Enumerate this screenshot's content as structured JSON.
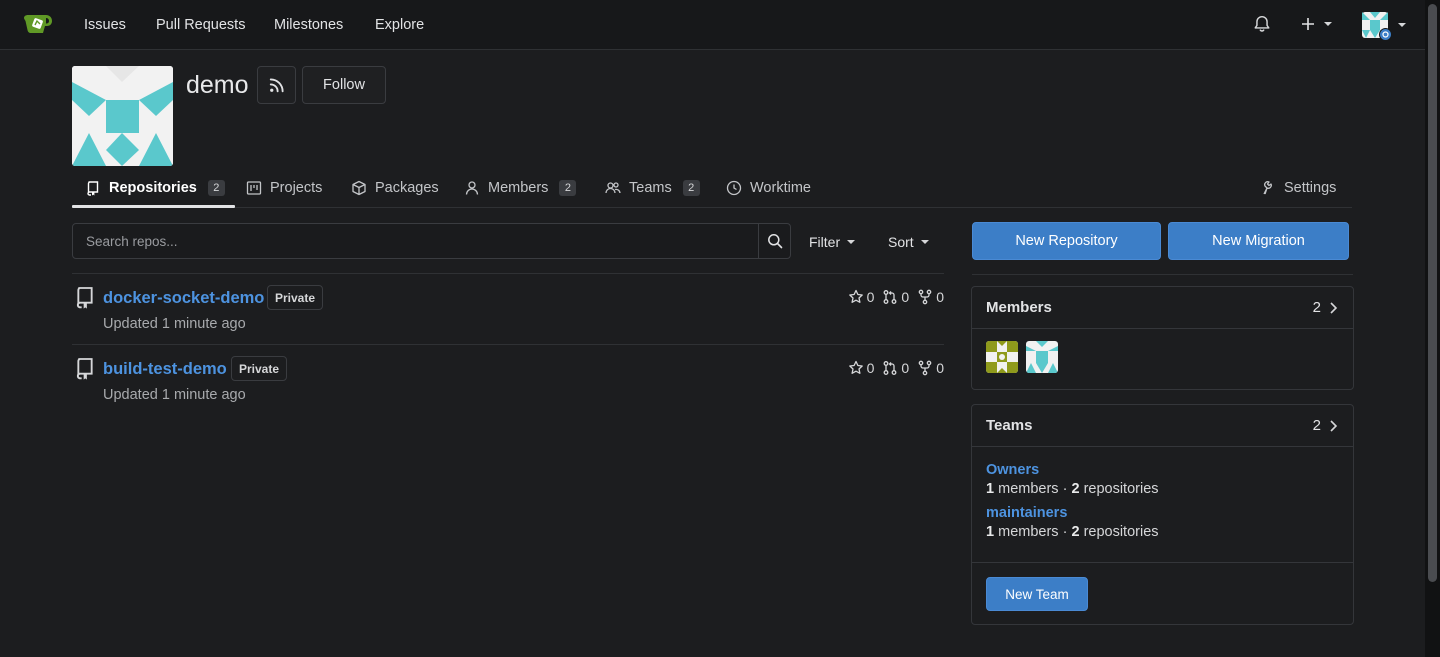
{
  "navbar": {
    "links": [
      "Issues",
      "Pull Requests",
      "Milestones",
      "Explore"
    ],
    "icons": [
      "gitea-logo-icon",
      "bell-icon",
      "plus-icon",
      "user-avatar"
    ]
  },
  "org": {
    "name": "demo",
    "follow_label": "Follow"
  },
  "tabs": [
    {
      "label": "Repositories",
      "badge": "2",
      "icon": "repo-icon"
    },
    {
      "label": "Projects",
      "badge": "",
      "icon": "project-icon"
    },
    {
      "label": "Packages",
      "badge": "",
      "icon": "package-icon"
    },
    {
      "label": "Members",
      "badge": "2",
      "icon": "person-icon"
    },
    {
      "label": "Teams",
      "badge": "2",
      "icon": "people-icon"
    },
    {
      "label": "Worktime",
      "badge": "",
      "icon": "clock-icon"
    },
    {
      "label": "Settings",
      "badge": "",
      "icon": "tools-icon"
    }
  ],
  "search": {
    "placeholder": "Search repos...",
    "filter_label": "Filter",
    "sort_label": "Sort"
  },
  "repos": [
    {
      "name": "docker-socket-demo",
      "visibility": "Private",
      "updated": "Updated 1 minute ago",
      "stars": "0",
      "prs": "0",
      "forks": "0"
    },
    {
      "name": "build-test-demo",
      "visibility": "Private",
      "updated": "Updated 1 minute ago",
      "stars": "0",
      "prs": "0",
      "forks": "0"
    }
  ],
  "actions": {
    "new_repository": "New Repository",
    "new_migration": "New Migration"
  },
  "members_card": {
    "title": "Members",
    "count": "2"
  },
  "teams_card": {
    "title": "Teams",
    "count": "2",
    "teams": [
      {
        "name": "Owners",
        "members": "1",
        "members_label": "members",
        "sep": "·",
        "repos": "2",
        "repos_label": "repositories"
      },
      {
        "name": "maintainers",
        "members": "1",
        "members_label": "members",
        "sep": "·",
        "repos": "2",
        "repos_label": "repositories"
      }
    ],
    "new_team_label": "New Team"
  },
  "colors": {
    "background": "#1c1d1f",
    "navbar": "#17181a",
    "link": "#4d93e0",
    "primary_button": "#3c7ec7",
    "avatar_teal": "#5ac8cc",
    "avatar_olive": "#8f9a1c"
  }
}
